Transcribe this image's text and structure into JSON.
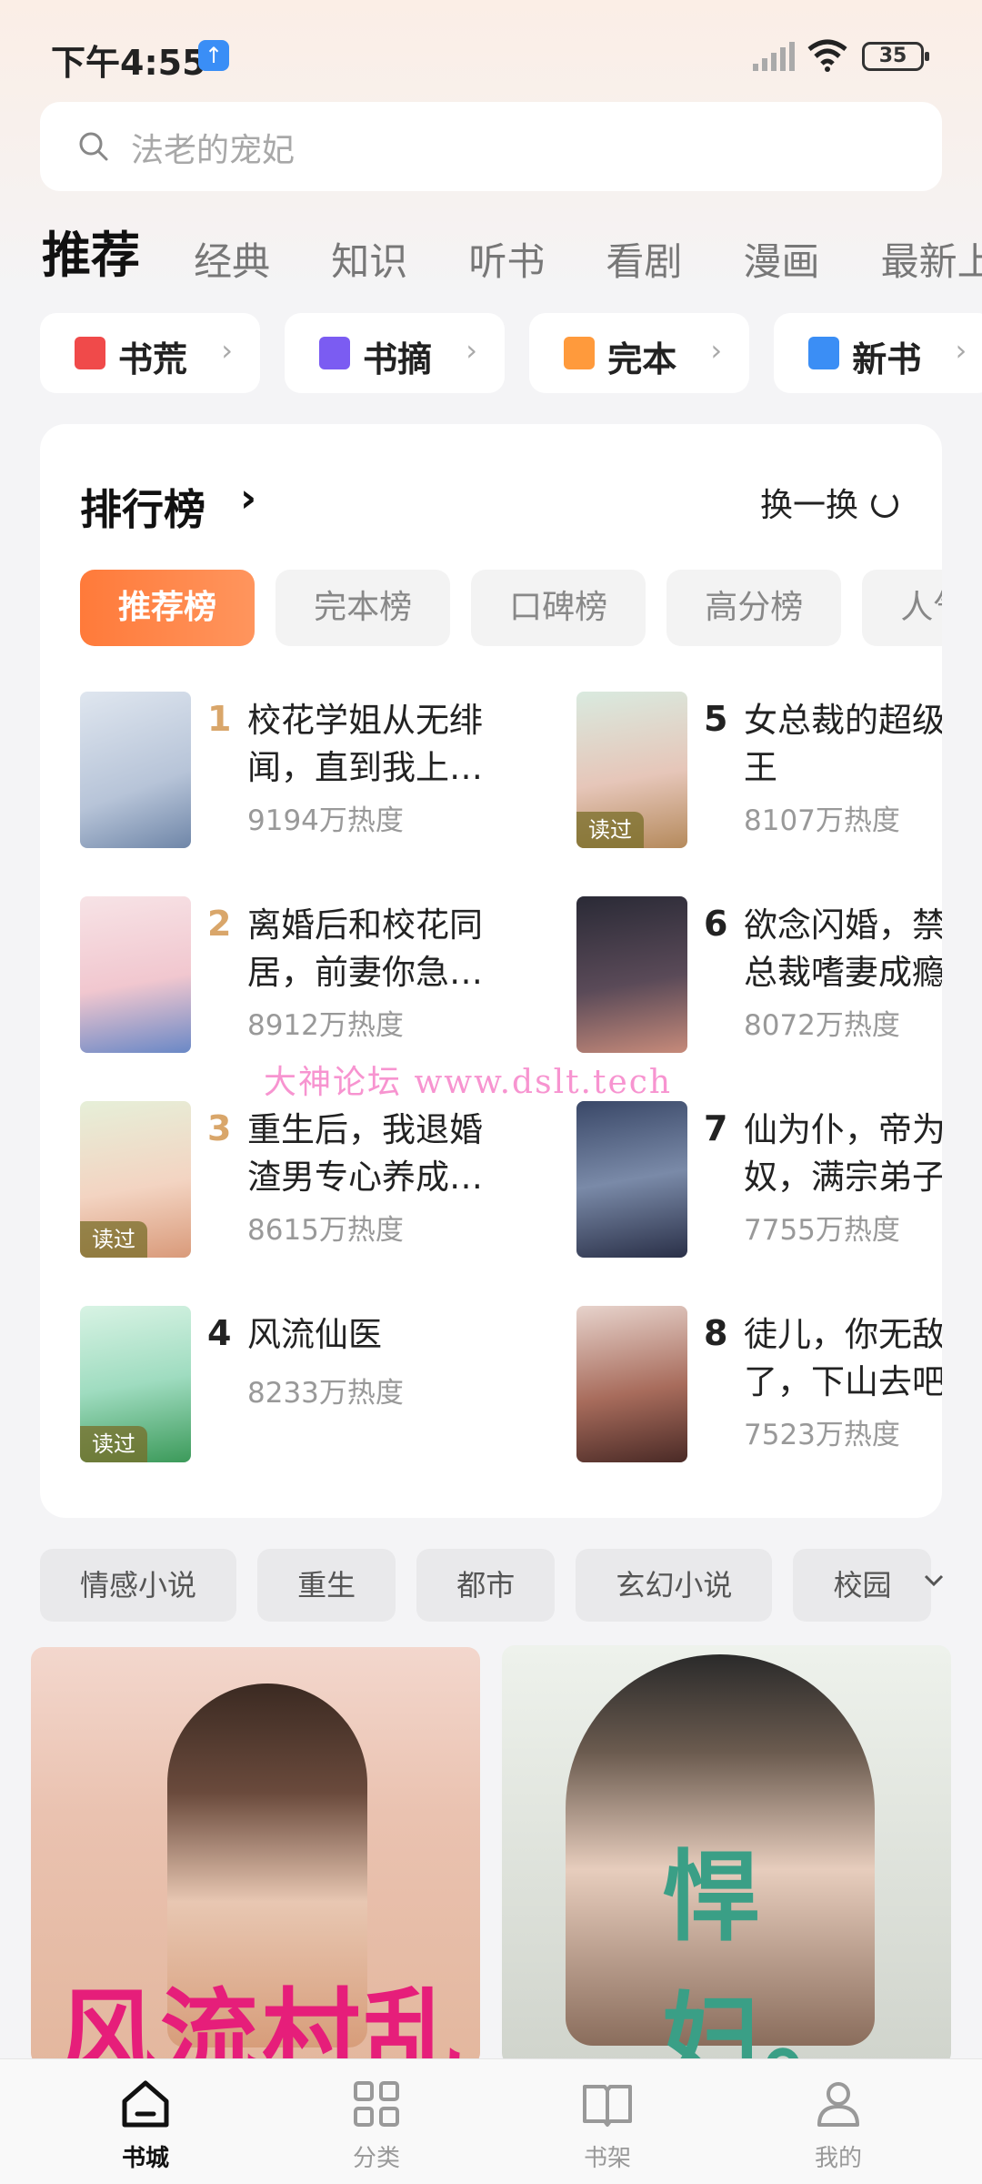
{
  "status_bar": {
    "time": "下午4:55",
    "battery": "35"
  },
  "search": {
    "placeholder": "法老的宠妃"
  },
  "main_tabs": [
    "推荐",
    "经典",
    "知识",
    "听书",
    "看剧",
    "漫画",
    "最新上架"
  ],
  "quick_chips": [
    {
      "label": "书荒",
      "icon": "bookshelf-tag-icon",
      "color": "#f04a4a"
    },
    {
      "label": "书摘",
      "icon": "bookmark-icon",
      "color": "#7b5cf2"
    },
    {
      "label": "完本",
      "icon": "book-complete-icon",
      "color": "#ff9a3c"
    },
    {
      "label": "新书",
      "icon": "new-flag-icon",
      "color": "#3b8ef5"
    }
  ],
  "ranking": {
    "title": "排行榜",
    "refresh_label": "换一换",
    "tabs": [
      "推荐榜",
      "完本榜",
      "口碑榜",
      "高分榜",
      "人气榜"
    ],
    "books": [
      {
        "rank": "1",
        "title": "校花学姐从无绯闻，直到我上…",
        "heat": "9194万热度",
        "read": ""
      },
      {
        "rank": "2",
        "title": "离婚后和校花同居，前妻你急…",
        "heat": "8912万热度",
        "read": ""
      },
      {
        "rank": "3",
        "title": "重生后，我退婚渣男专心养成…",
        "heat": "8615万热度",
        "read": "读过"
      },
      {
        "rank": "4",
        "title": "风流仙医",
        "heat": "8233万热度",
        "read": "读过"
      },
      {
        "rank": "5",
        "title": "女总裁的超级兵王",
        "heat": "8107万热度",
        "read": "读过"
      },
      {
        "rank": "6",
        "title": "欲念闪婚，禁欲总裁嗜妻成瘾",
        "heat": "8072万热度",
        "read": ""
      },
      {
        "rank": "7",
        "title": "仙为仆，帝为奴，满宗弟子",
        "heat": "7755万热度",
        "read": ""
      },
      {
        "rank": "8",
        "title": "徒儿，你无敌了，下山去吧",
        "heat": "7523万热度",
        "read": ""
      }
    ]
  },
  "watermark": "大神论坛   www.dslt.tech",
  "categories": [
    "情感小说",
    "重生",
    "都市",
    "玄幻小说",
    "校园"
  ],
  "feed": {
    "card1_text": "风流村乱",
    "card2_text": "悍妇。"
  },
  "bottom_nav": [
    {
      "label": "书城",
      "active": true
    },
    {
      "label": "分类",
      "active": false
    },
    {
      "label": "书架",
      "active": false
    },
    {
      "label": "我的",
      "active": false
    }
  ],
  "colors": {
    "accent": "#ff7a3a",
    "rank_top3": "#d9a66a"
  }
}
